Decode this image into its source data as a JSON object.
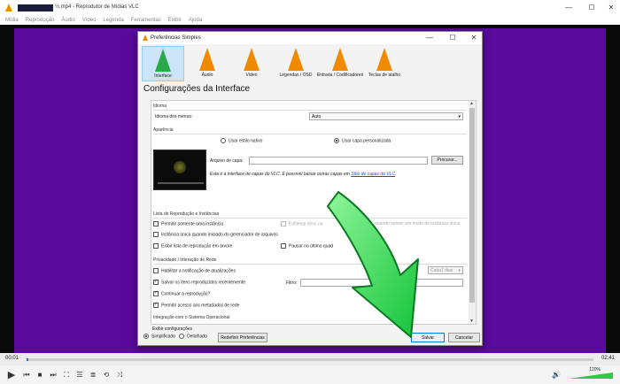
{
  "window": {
    "title": "½.mp4 - Reprodutor de Mídias VLC",
    "minimize": "—",
    "maximize": "☐",
    "close": "✕"
  },
  "menu": [
    "Mídia",
    "Reprodução",
    "Áudio",
    "Vídeo",
    "Legenda",
    "Ferramentas",
    "Exibir",
    "Ajuda"
  ],
  "player": {
    "time_current": "00:01",
    "time_total": "02:41",
    "volume": "120%",
    "progress_fraction": 0.003
  },
  "dialog": {
    "title": "Preferências Simples",
    "minimize": "—",
    "maximize": "☐",
    "close": "✕",
    "categories": [
      {
        "label": "Interface",
        "icon": "interface-cone-icon",
        "active": true
      },
      {
        "label": "Áudio",
        "icon": "audio-cone-icon",
        "active": false
      },
      {
        "label": "Vídeo",
        "icon": "video-cone-icon",
        "active": false
      },
      {
        "label": "Legendas / OSD",
        "icon": "subtitles-cone-icon",
        "active": false
      },
      {
        "label": "Entrada / Codificadores",
        "icon": "input-cone-icon",
        "active": false
      },
      {
        "label": "Teclas de atalho",
        "icon": "hotkeys-cone-icon",
        "active": false
      }
    ],
    "section_title": "Configurações da Interface",
    "language": {
      "group": "Idioma",
      "label": "Idioma dos menus:",
      "value": "Auto"
    },
    "appearance": {
      "group": "Aparência",
      "native": "Usar estilo nativo",
      "custom": "Usar capa personalizada",
      "skin_label": "Arquivo de capa:",
      "browse": "Procurar...",
      "note": "Esta é a interface de capas do VLC. É possível baixar outras capas em",
      "link": "Sítio de capas do VLC",
      "note_end": "."
    },
    "playlist": {
      "group": "Lista de Reprodução e Instâncias",
      "one_instance": "Permitir somente uma instância",
      "enqueue_partial": "Enfileirar itens na",
      "partial_right": "quando estiver em modo de instância única",
      "file_manager": "Instância única quando iniciado do gerenciador de arquivos",
      "tree": "Exibir lista de reprodução em árvore",
      "pause_last": "Pausar no último quad"
    },
    "privacy": {
      "group": "Privacidade / Interação de Rede",
      "updates": "Habilitar a notificação de atualizações",
      "every": "Cada7 dias",
      "recent": "Salvar os itens reproduzidos recentemente",
      "filter": "Filtro:",
      "continue": "Continuar a reprodução?",
      "metadata": "Permitir acesso aos metadados de rede"
    },
    "os_integration": "Integração com o Sistema Operacional",
    "footer": {
      "show_settings": "Exibir configurações",
      "simple": "Simplificado",
      "detailed": "Detalhado",
      "reset": "Redefinir Preferências",
      "save": "Salvar",
      "cancel": "Cancelar"
    }
  },
  "colors": {
    "video_bg": "#5a0a9c",
    "accent_arrow": "#27d64a",
    "vlc_orange": "#f08a00",
    "active_category": "#cce4f7"
  }
}
